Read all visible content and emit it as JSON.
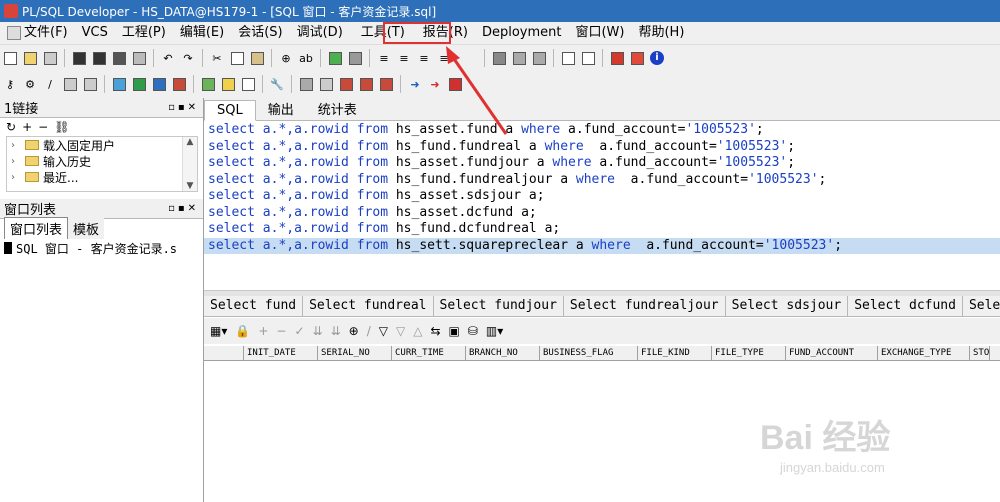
{
  "window": {
    "title": "PL/SQL Developer - HS_DATA@HS179-1 - [SQL 窗口 - 客户资金记录.sql]"
  },
  "menu": [
    {
      "label": "文件(F)"
    },
    {
      "label": "VCS"
    },
    {
      "label": "工程(P)"
    },
    {
      "label": "编辑(E)"
    },
    {
      "label": "会话(S)"
    },
    {
      "label": "调试(D)"
    },
    {
      "label": "工具(T)"
    },
    {
      "label": "报告(R)"
    },
    {
      "label": "Deployment"
    },
    {
      "label": "窗口(W)"
    },
    {
      "label": "帮助(H)"
    }
  ],
  "connections": {
    "title": "1链接",
    "items": [
      {
        "label": "载入固定用户"
      },
      {
        "label": "输入历史"
      },
      {
        "label": "最近..."
      }
    ]
  },
  "window_list": {
    "title": "窗口列表",
    "tabs": [
      "窗口列表",
      "模板"
    ],
    "items": [
      "SQL 窗口 - 客户资金记录.s"
    ]
  },
  "editor_tabs": [
    "SQL",
    "输出",
    "统计表"
  ],
  "sql_lines": [
    {
      "pre": "select a.*,a.rowid ",
      "from": "from",
      "tbl": " hs_asset.fund a ",
      "where": "where",
      "cond": " a.fund_account=",
      "val": "'1005523'",
      "end": ";"
    },
    {
      "pre": "select a.*,a.rowid ",
      "from": "from",
      "tbl": " hs_fund.fundreal a ",
      "where": "where",
      "cond": "  a.fund_account=",
      "val": "'1005523'",
      "end": ";"
    },
    {
      "pre": "select a.*,a.rowid ",
      "from": "from",
      "tbl": " hs_asset.fundjour a ",
      "where": "where",
      "cond": " a.fund_account=",
      "val": "'1005523'",
      "end": ";"
    },
    {
      "pre": "select a.*,a.rowid ",
      "from": "from",
      "tbl": " hs_fund.fundrealjour a ",
      "where": "where",
      "cond": "  a.fund_account=",
      "val": "'1005523'",
      "end": ";"
    },
    {
      "pre": "select a.*,a.rowid ",
      "from": "from",
      "tbl": " hs_asset.sdsjour a;",
      "where": "",
      "cond": "",
      "val": "",
      "end": ""
    },
    {
      "pre": "select a.*,a.rowid ",
      "from": "from",
      "tbl": " hs_asset.dcfund a;",
      "where": "",
      "cond": "",
      "val": "",
      "end": ""
    },
    {
      "pre": "select a.*,a.rowid ",
      "from": "from",
      "tbl": " hs_fund.dcfundreal a;",
      "where": "",
      "cond": "",
      "val": "",
      "end": ""
    },
    {
      "pre": "select a.*,a.rowid ",
      "from": "from",
      "tbl": " hs_sett.squarepreclear a ",
      "where": "where",
      "cond": "  a.fund_account=",
      "val": "'1005523'",
      "end": ";"
    }
  ],
  "result_tabs": [
    "Select fund",
    "Select fundreal",
    "Select fundjour",
    "Select fundrealjour",
    "Select sdsjour",
    "Select dcfund",
    "Select"
  ],
  "grid_columns": [
    "INIT_DATE",
    "SERIAL_NO",
    "CURR_TIME",
    "BRANCH_NO",
    "BUSINESS_FLAG",
    "FILE_KIND",
    "FILE_TYPE",
    "FUND_ACCOUNT",
    "EXCHANGE_TYPE",
    "STO"
  ],
  "watermark": {
    "brand": "Bai 经验",
    "url": "jingyan.baidu.com"
  },
  "colors": {
    "titlebar": "#2d6fb8",
    "highlight": "#e03030",
    "keyword": "#1a3fc4",
    "selection": "#c6dcf2"
  }
}
